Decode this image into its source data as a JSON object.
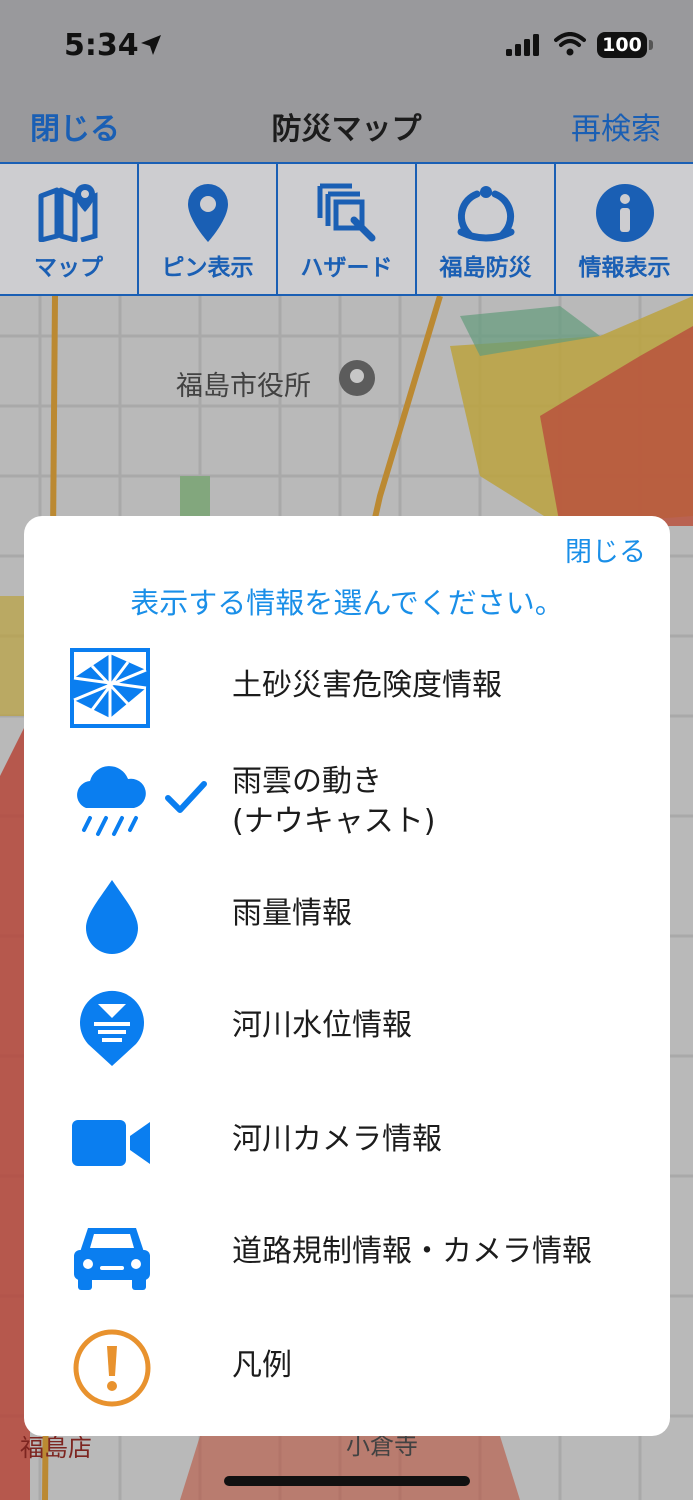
{
  "status_bar": {
    "time": "5:34",
    "battery": "100"
  },
  "nav": {
    "close_label": "閉じる",
    "title": "防災マップ",
    "research_label": "再検索"
  },
  "toolbar": [
    {
      "label": "マップ",
      "icon": "map-pin-icon"
    },
    {
      "label": "ピン表示",
      "icon": "pin-icon"
    },
    {
      "label": "ハザード",
      "icon": "hazard-layers-icon"
    },
    {
      "label": "福島防災",
      "icon": "fukushima-logo-icon"
    },
    {
      "label": "情報表示",
      "icon": "info-icon"
    }
  ],
  "map": {
    "labels": {
      "city_hall": "福島市役所",
      "temple": "小倉寺",
      "store": "福島店"
    }
  },
  "modal": {
    "close_label": "閉じる",
    "prompt": "表示する情報を選んでください。",
    "options": [
      {
        "label": "土砂災害危険度情報",
        "icon": "landslide-grid-icon",
        "checked": false
      },
      {
        "label_line1": "雨雲の動き",
        "label_line2": "(ナウキャスト)",
        "icon": "rain-cloud-icon",
        "checked": true
      },
      {
        "label": "雨量情報",
        "icon": "raindrop-icon",
        "checked": false
      },
      {
        "label": "河川水位情報",
        "icon": "river-level-icon",
        "checked": false
      },
      {
        "label": "河川カメラ情報",
        "icon": "video-camera-icon",
        "checked": false
      },
      {
        "label": "道路規制情報・カメラ情報",
        "icon": "car-icon",
        "checked": false
      },
      {
        "label": "凡例",
        "icon": "exclamation-icon",
        "checked": false
      }
    ]
  },
  "colors": {
    "accent": "#1a8fe8",
    "toolbar_blue": "#1a5fb4",
    "legend_orange": "#e8922e"
  }
}
